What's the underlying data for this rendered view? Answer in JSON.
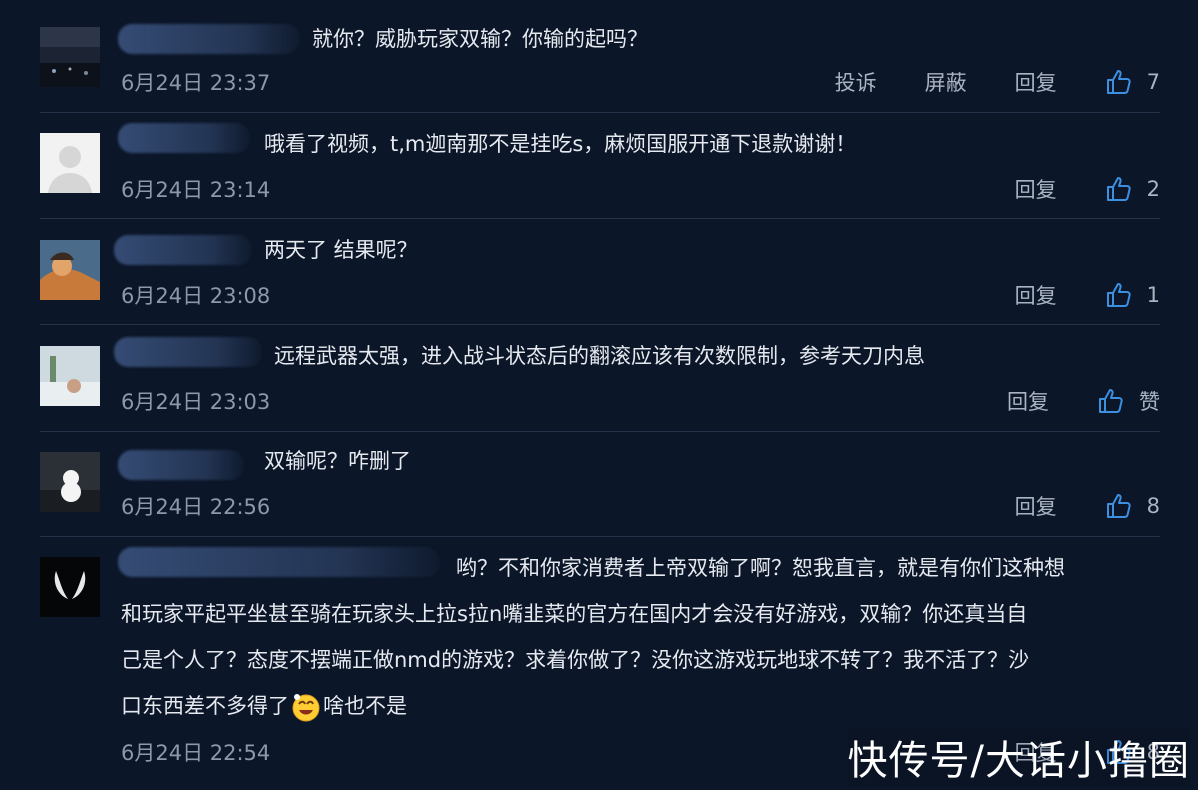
{
  "actions": {
    "report_label": "投诉",
    "block_label": "屏蔽",
    "reply_label": "回复"
  },
  "comments": [
    {
      "text": "就你？威胁玩家双输？你输的起吗？",
      "time": "6月24日 23:37",
      "likes": "7"
    },
    {
      "text": "哦看了视频，t,m迦南那不是挂吃s，麻烦国服开通下退款谢谢！",
      "time": "6月24日 23:14",
      "likes": "2"
    },
    {
      "text": "两天了 结果呢？",
      "time": "6月24日 23:08",
      "likes": "1"
    },
    {
      "text": "远程武器太强，进入战斗状态后的翻滚应该有次数限制，参考天刀内息",
      "time": "6月24日 23:03",
      "likes": "赞"
    },
    {
      "text": "双输呢？咋删了",
      "time": "6月24日 22:56",
      "likes": "8"
    },
    {
      "text_line1": "哟？不和你家消费者上帝双输了啊？恕我直言，就是有你们这种想",
      "text_line2": "和玩家平起平坐甚至骑在玩家头上拉s拉n嘴韭菜的官方在国内才会没有好游戏，双输？你还真当自",
      "text_line3": "己是个人了？态度不摆端正做nmd的游戏？求着你做了？没你这游戏玩地球不转了？我不活了？沙",
      "text_line4_a": "口东西差不多得了",
      "text_line4_b": "啥也不是",
      "time": "6月24日 22:54",
      "likes": "8"
    }
  ],
  "watermark": "快传号/大话小撸圈",
  "colors": {
    "background": "#0b1628",
    "text": "#e6e9ef",
    "meta": "#8d98ab"
  }
}
